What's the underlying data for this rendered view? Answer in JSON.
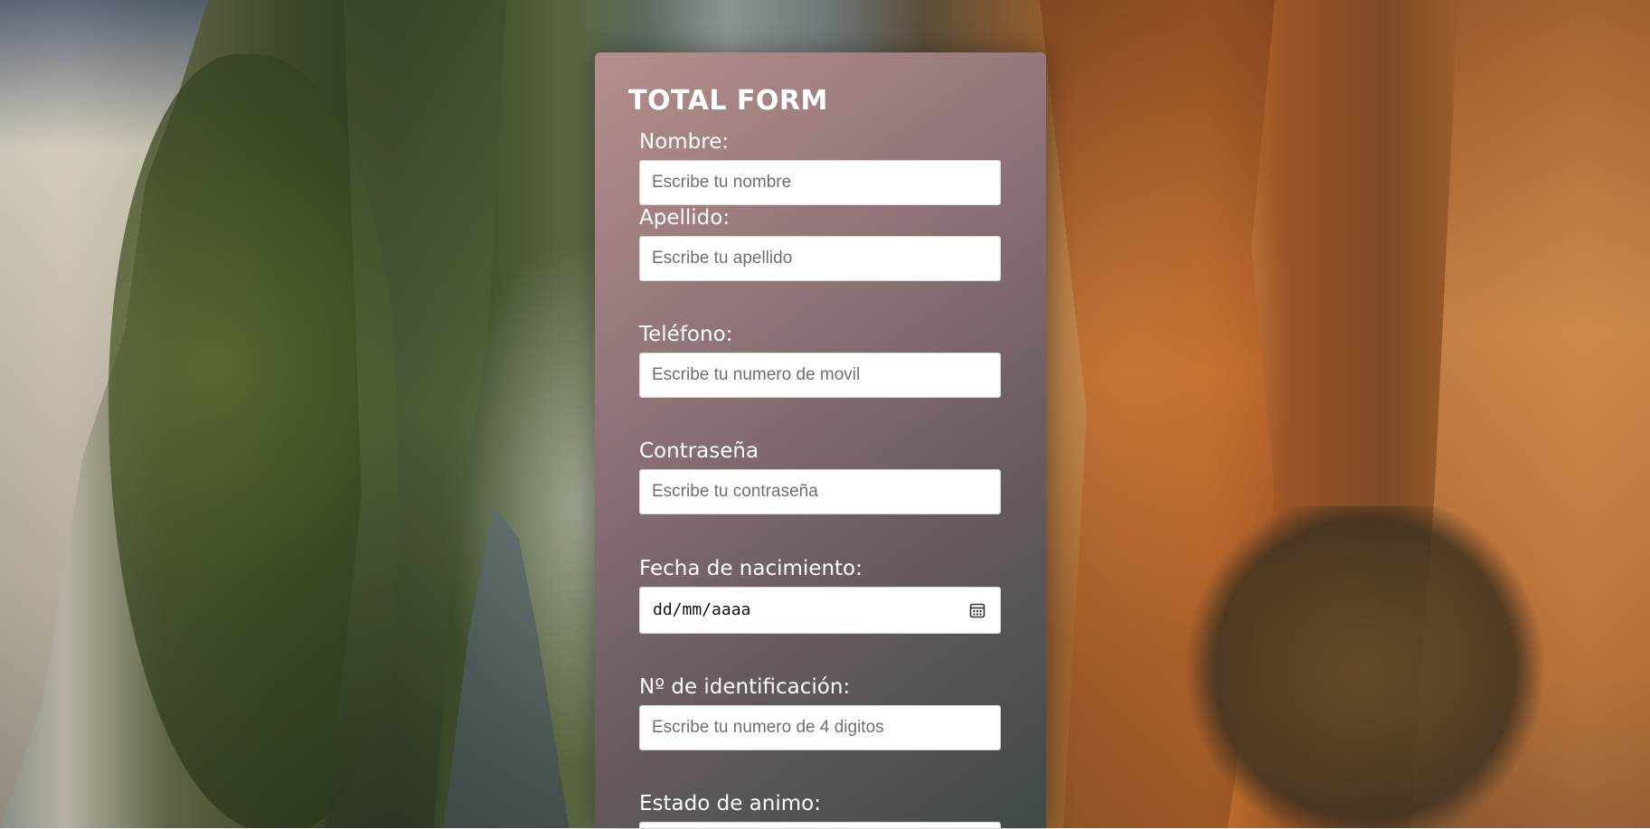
{
  "form": {
    "title": "TOTAL FORM",
    "fields": [
      {
        "label": "Nombre:",
        "placeholder": "Escribe tu nombre"
      },
      {
        "label": "Apellido:",
        "placeholder": "Escribe tu apellido"
      },
      {
        "label": "Teléfono:",
        "placeholder": "Escribe tu numero de movil"
      },
      {
        "label": "Contraseña",
        "placeholder": "Escribe tu contraseña"
      },
      {
        "label": "Fecha de nacimiento:",
        "value": "dd/mm/aaaa",
        "icon": "calendar-icon"
      },
      {
        "label": "Nº de identificación:",
        "placeholder": "Escribe tu numero de 4 digitos"
      },
      {
        "label": "Estado de animo:"
      }
    ]
  },
  "colors": {
    "panel_top": "#b58f8d",
    "panel_bottom": "#3f4a45",
    "text": "#ffffff"
  }
}
